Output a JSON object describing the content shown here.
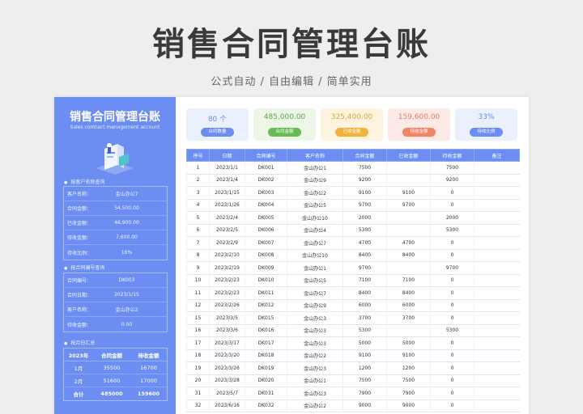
{
  "header": {
    "title": "销售合同管理台账",
    "subtitle": "公式自动 / 自由编辑 / 简单实用"
  },
  "sidebar": {
    "title": "销售合同管理台账",
    "subtitle": "Sales contract management account",
    "customer_section": {
      "title": "按客户名称查询",
      "rows": [
        {
          "key": "客户名称：",
          "value": "金山办公7"
        },
        {
          "key": "合同金额：",
          "value": "54,500.00"
        },
        {
          "key": "已收金额：",
          "value": "46,900.00"
        },
        {
          "key": "待收金额：",
          "value": "7,600.00"
        },
        {
          "key": "待收比例：",
          "value": "16%"
        }
      ]
    },
    "contract_section": {
      "title": "按合同编号查询",
      "rows": [
        {
          "key": "合同编号：",
          "value": "DK003"
        },
        {
          "key": "合同日期：",
          "value": "2023/1/15"
        },
        {
          "key": "客户名称：",
          "value": "金山办公2"
        },
        {
          "key": "待收金额：",
          "value": "0.00"
        }
      ]
    },
    "month_section": {
      "title": "按月份汇总",
      "headers": [
        "2023年",
        "合同金额",
        "待收金额"
      ],
      "rows": [
        [
          "1月",
          "35500",
          "16700"
        ],
        [
          "2月",
          "51600",
          "17000"
        ]
      ],
      "total": [
        "合计",
        "485000",
        "159600"
      ]
    }
  },
  "cards": [
    {
      "value": "80 个",
      "tag": "合同数量",
      "bg": "#eaf0fd",
      "fg": "#6c8ef3",
      "tagbg": "#6c8ef3"
    },
    {
      "value": "485,000.00",
      "tag": "合同金额",
      "bg": "#eef6e8",
      "fg": "#5aa94a",
      "tagbg": "#68bb55"
    },
    {
      "value": "325,400.00",
      "tag": "已收金额",
      "bg": "#fdf3df",
      "fg": "#e3a43a",
      "tagbg": "#f1b33d"
    },
    {
      "value": "159,600.00",
      "tag": "待收金额",
      "bg": "#fdeae6",
      "fg": "#ea7b62",
      "tagbg": "#f08567"
    },
    {
      "value": "33%",
      "tag": "待收比例",
      "bg": "#eaf0fd",
      "fg": "#6c8ef3",
      "tagbg": "#6c8ef3"
    }
  ],
  "table": {
    "headers": [
      "序号",
      "日期",
      "合同编号",
      "客户名称",
      "合同金额",
      "已收金额",
      "待收金额",
      "备注"
    ],
    "rows": [
      [
        "1",
        "2023/1/1",
        "DK001",
        "金山办公1",
        "7500",
        "",
        "7500",
        ""
      ],
      [
        "2",
        "2023/1/4",
        "DK002",
        "金山办公9",
        "9200",
        "",
        "9200",
        ""
      ],
      [
        "3",
        "2023/1/15",
        "DK003",
        "金山办公2",
        "9100",
        "9100",
        "0",
        ""
      ],
      [
        "4",
        "2023/1/26",
        "DK004",
        "金山办公5",
        "9700",
        "9700",
        "0",
        ""
      ],
      [
        "5",
        "2023/2/4",
        "DK005",
        "金山办公10",
        "2000",
        "",
        "2000",
        ""
      ],
      [
        "6",
        "2023/2/5",
        "DK006",
        "金山办公4",
        "5300",
        "",
        "5300",
        ""
      ],
      [
        "7",
        "2023/2/9",
        "DK007",
        "金山办公7",
        "4700",
        "4700",
        "0",
        ""
      ],
      [
        "8",
        "2023/2/10",
        "DK008",
        "金山办公10",
        "8400",
        "8400",
        "0",
        ""
      ],
      [
        "9",
        "2023/2/19",
        "DK009",
        "金山办公1",
        "9700",
        "",
        "9700",
        ""
      ],
      [
        "10",
        "2023/2/23",
        "DK010",
        "金山办公5",
        "7100",
        "7100",
        "0",
        ""
      ],
      [
        "11",
        "2023/2/23",
        "DK011",
        "金山办公7",
        "8400",
        "8400",
        "0",
        ""
      ],
      [
        "12",
        "2023/2/26",
        "DK012",
        "金山办公9",
        "6000",
        "6000",
        "0",
        ""
      ],
      [
        "15",
        "2023/3/5",
        "DK015",
        "金山办公3",
        "3700",
        "3700",
        "0",
        ""
      ],
      [
        "16",
        "2023/3/6",
        "DK016",
        "金山办公3",
        "5300",
        "",
        "5300",
        ""
      ],
      [
        "17",
        "2023/3/17",
        "DK017",
        "金山办公3",
        "5000",
        "5000",
        "0",
        ""
      ],
      [
        "18",
        "2023/3/20",
        "DK018",
        "金山办公2",
        "9100",
        "9100",
        "0",
        ""
      ],
      [
        "19",
        "2023/3/26",
        "DK019",
        "金山办公3",
        "1200",
        "1200",
        "0",
        ""
      ],
      [
        "20",
        "2023/3/28",
        "DK020",
        "金山办公1",
        "7500",
        "7500",
        "0",
        ""
      ],
      [
        "31",
        "2023/5/7",
        "DK031",
        "金山办公3",
        "7900",
        "7900",
        "0",
        ""
      ],
      [
        "32",
        "2023/6/16",
        "DK032",
        "金山办公2",
        "9000",
        "9000",
        "0",
        ""
      ]
    ]
  }
}
